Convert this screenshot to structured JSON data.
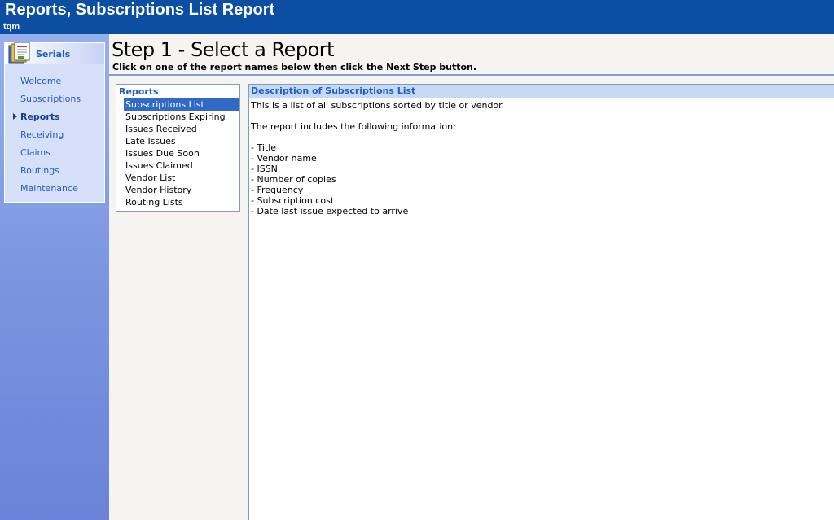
{
  "window": {
    "title": "Reports, Subscriptions List Report",
    "user": "tqm"
  },
  "sidebar": {
    "section_label": "Serials",
    "items": [
      {
        "label": "Welcome",
        "active": false
      },
      {
        "label": "Subscriptions",
        "active": false
      },
      {
        "label": "Reports",
        "active": true
      },
      {
        "label": "Receiving",
        "active": false
      },
      {
        "label": "Claims",
        "active": false
      },
      {
        "label": "Routings",
        "active": false
      },
      {
        "label": "Maintenance",
        "active": false
      }
    ]
  },
  "main": {
    "step_title": "Step 1 - Select a Report",
    "instructions": "Click on one of the report names below then click the Next Step button.",
    "reports": {
      "header": "Reports",
      "items": [
        "Subscriptions List",
        "Subscriptions Expiring",
        "Issues Received",
        "Late Issues",
        "Issues Due Soon",
        "Issues Claimed",
        "Vendor List",
        "Vendor History",
        "Routing Lists"
      ],
      "selected": "Subscriptions List"
    },
    "description": {
      "header": "Description of Subscriptions List",
      "intro": "This is a list of all subscriptions sorted by title or vendor.",
      "includes": "The report includes the following information:",
      "fields": [
        "- Title",
        "- Vendor name",
        "- ISSN",
        "- Number of copies",
        "- Frequency",
        "- Subscription cost",
        "- Date last issue expected to arrive"
      ]
    }
  },
  "colors": {
    "titlebar": "#0b4ea2",
    "link": "#215dc6",
    "selection": "#316ac5",
    "desc_header": "#c6daf8"
  }
}
